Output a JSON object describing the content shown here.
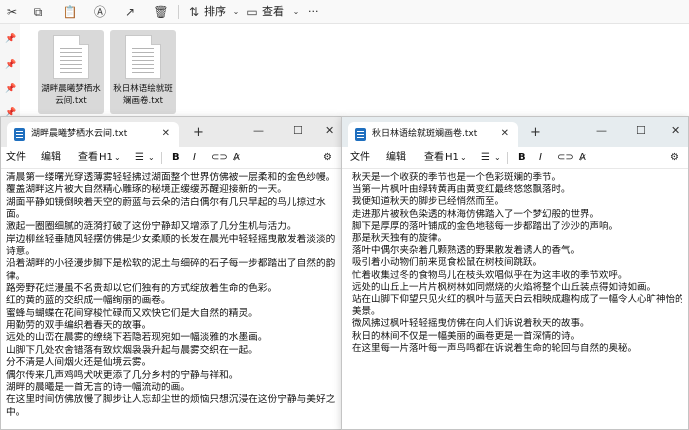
{
  "explorer": {
    "toolbar": {
      "sort_label": "排序",
      "view_label": "查看",
      "more_label": "···"
    },
    "files": [
      {
        "name": "湖畔晨曦梦栖水云间.txt"
      },
      {
        "name": "秋日林语绘就斑斓画卷.txt"
      }
    ]
  },
  "windows": [
    {
      "tab_title": "湖畔晨曦梦栖水云间.txt",
      "menus": {
        "file": "文件",
        "edit": "编辑",
        "view": "查看",
        "heading": "H1",
        "bold": "B",
        "italic": "I"
      },
      "lines": [
        "清晨第一缕曙光穿透薄雾轻轻拂过湖面整个世界仿佛被一层柔和的金色纱幔。",
        "覆盖湖畔这片被大自然精心雕琢的秘境正缓缓苏醒迎接新的一天。",
        "湖面平静如镜倒映着天空的蔚蓝与云朵的洁白偶尔有几只早起的鸟儿掠过水",
        "面。",
        "激起一圈圈细腻的涟漪打破了这份宁静却又增添了几分生机与活力。",
        "岸边柳丝轻垂随风轻摆仿佛是少女柔顺的长发在晨光中轻轻摇曳散发着淡淡的",
        "诗意。",
        "沿着湖畔的小径漫步脚下是松软的泥土与细碎的石子每一步都踏出了自然的韵",
        "律。",
        "路旁野花烂漫虽不名贵却以它们独有的方式绽放着生命的色彩。",
        "红的黄的蓝的交织成一幅绚丽的画卷。",
        "蜜蜂与蝴蝶在花间穿梭忙碌而又欢快它们是大自然的精灵。",
        "用勤劳的双手编织着春天的故事。",
        "远处的山峦在晨雾的缭绕下若隐若现宛如一幅淡雅的水墨画。",
        "山脚下几处农舍错落有致炊烟袅袅升起与晨雾交织在一起。",
        "分不清是人间烟火还是仙境云雾。",
        "偶尔传来几声鸡鸣犬吠更添了几分乡村的宁静与祥和。",
        "湖畔的晨曦是一首无言的诗一幅流动的画。",
        "在这里时间仿佛放慢了脚步让人忘却尘世的烦恼只想沉浸在这份宁静与美好之",
        "中。"
      ]
    },
    {
      "tab_title": "秋日林语绘就斑斓画卷.txt",
      "menus": {
        "file": "文件",
        "edit": "编辑",
        "view": "查看",
        "heading": "H1",
        "bold": "B",
        "italic": "I"
      },
      "lines": [
        "秋天是一个收获的季节也是一个色彩斑斓的季节。",
        "当第一片枫叶由绿转黄再由黄变红最终悠悠飘落时。",
        "我便知道秋天的脚步已经悄然而至。",
        "走进那片被秋色染透的林海仿佛踏入了一个梦幻般的世界。",
        "脚下是厚厚的落叶铺成的金色地毯每一步都踏出了沙沙的声响。",
        "那是秋天独有的旋律。",
        "落叶中偶尔夹杂着几颗熟透的野果散发着诱人的香气。",
        "吸引着小动物们前来觅食松鼠在树枝间跳跃。",
        "忙着收集过冬的食物鸟儿在枝头欢唱似乎在为这丰收的季节欢呼。",
        "远处的山丘上一片片枫树林如同燃烧的火焰将整个山丘装点得如诗如画。",
        "站在山脚下仰望只见火红的枫叶与蓝天白云相映成趣构成了一幅令人心旷神怡的",
        "美景。",
        "微风拂过枫叶轻轻摇曳仿佛在向人们诉说着秋天的故事。",
        "秋日的林间不仅是一幅美丽的画卷更是一首深情的诗。",
        "在这里每一片落叶每一声鸟鸣都在诉说着生命的轮回与自然的奥秘。"
      ]
    }
  ]
}
